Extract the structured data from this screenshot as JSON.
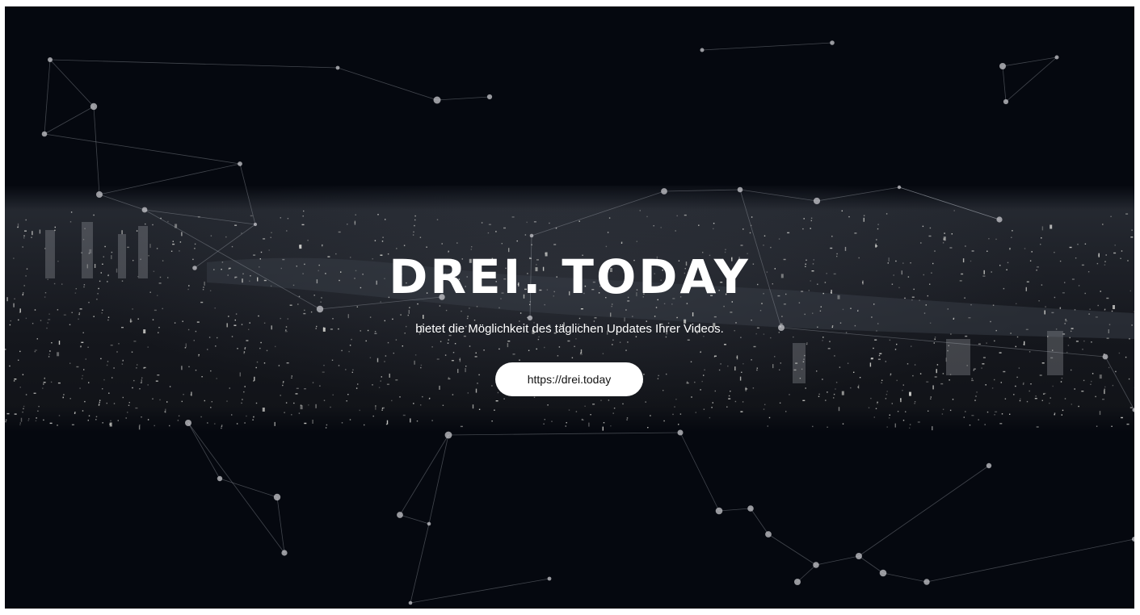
{
  "hero": {
    "title": "DREI. TODAY",
    "subtitle": "bietet die Möglichkeit des täglichen Updates Ihrer Videos.",
    "button_label": "https://drei.today"
  },
  "colors": {
    "background": "#05080f",
    "text": "#ffffff",
    "button_bg": "#ffffff",
    "button_text": "#111111"
  }
}
